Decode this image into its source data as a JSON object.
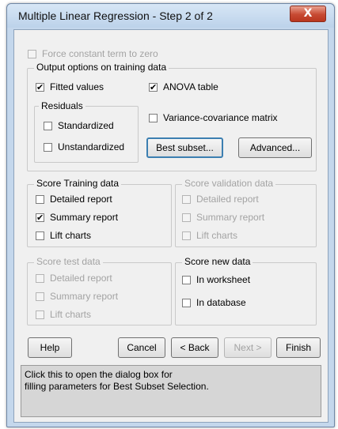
{
  "window": {
    "title": "Multiple Linear Regression - Step 2 of 2",
    "close_glyph": "X"
  },
  "force_constant": {
    "label": "Force constant term to zero",
    "checked": false,
    "enabled": false
  },
  "output_options": {
    "legend": "Output options on training data",
    "fitted_values": {
      "label": "Fitted values",
      "checked": true
    },
    "anova_table": {
      "label": "ANOVA table",
      "checked": true
    },
    "residuals": {
      "legend": "Residuals",
      "standardized": {
        "label": "Standardized",
        "checked": false
      },
      "unstandardized": {
        "label": "Unstandardized",
        "checked": false
      }
    },
    "variance_covariance": {
      "label": "Variance-covariance matrix",
      "checked": false
    },
    "best_subset_button": "Best subset...",
    "advanced_button": "Advanced..."
  },
  "score_training": {
    "legend": "Score Training data",
    "detailed_report": {
      "label": "Detailed report",
      "checked": false
    },
    "summary_report": {
      "label": "Summary report",
      "checked": true
    },
    "lift_charts": {
      "label": "Lift charts",
      "checked": false
    }
  },
  "score_validation": {
    "legend": "Score validation data",
    "detailed_report": {
      "label": "Detailed report",
      "checked": false
    },
    "summary_report": {
      "label": "Summary report",
      "checked": false
    },
    "lift_charts": {
      "label": "Lift charts",
      "checked": false
    }
  },
  "score_test": {
    "legend": "Score test data",
    "detailed_report": {
      "label": "Detailed report",
      "checked": false
    },
    "summary_report": {
      "label": "Summary report",
      "checked": false
    },
    "lift_charts": {
      "label": "Lift charts",
      "checked": false
    }
  },
  "score_new": {
    "legend": "Score new data",
    "in_worksheet": {
      "label": "In worksheet",
      "checked": false
    },
    "in_database": {
      "label": "In database",
      "checked": false
    }
  },
  "buttons": {
    "help": "Help",
    "cancel": "Cancel",
    "back": "< Back",
    "next": "Next >",
    "finish": "Finish"
  },
  "description": {
    "line1": "Click this to open the dialog box for",
    "line2": "filling parameters for Best Subset Selection."
  },
  "check_glyph": "✔",
  "colors": {
    "title_bar": "#bcd2ea",
    "close_button": "#c74a32",
    "focus_border": "#3c7fb1",
    "disabled_text": "#a3a3a3"
  }
}
